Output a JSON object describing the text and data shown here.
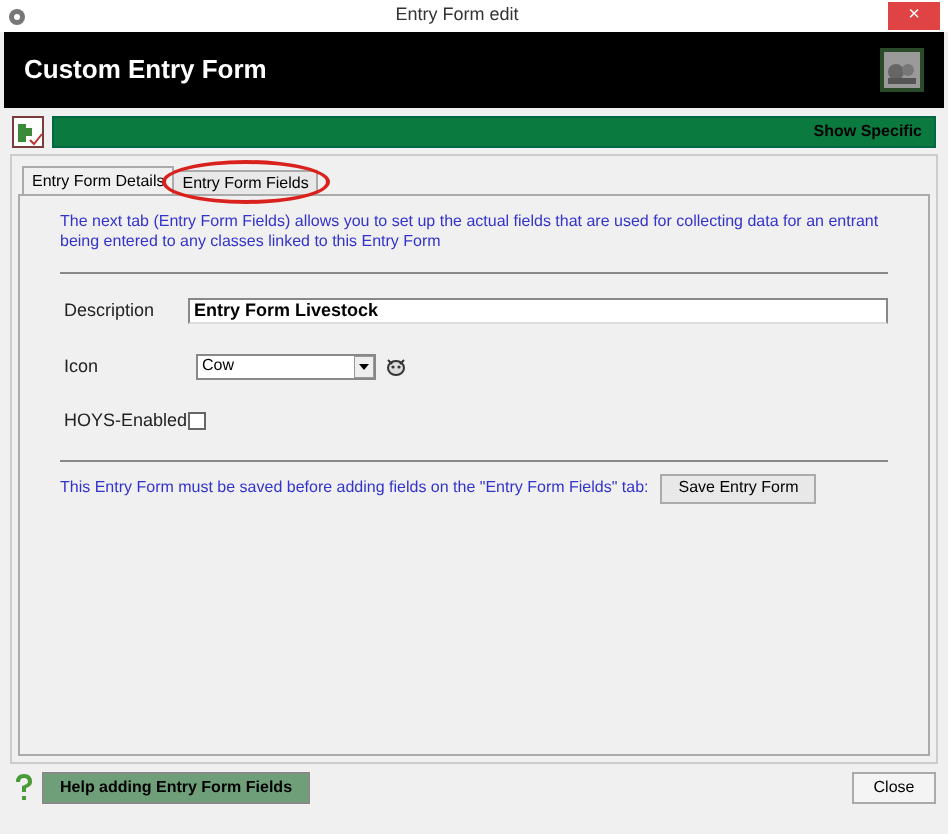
{
  "window": {
    "title": "Entry Form edit",
    "close": "×"
  },
  "header": {
    "title": "Custom Entry Form"
  },
  "toolbar": {
    "button": "Show Specific"
  },
  "tabs": [
    {
      "label": "Entry Form Details",
      "selected": true
    },
    {
      "label": "Entry Form Fields",
      "selected": false,
      "highlighted": true
    }
  ],
  "intro": "The next tab (Entry Form Fields) allows you to set up the actual fields that are used for collecting data for an entrant being entered to any classes linked to this Entry Form",
  "fields": [
    {
      "kind": "text",
      "label": "Description",
      "value": "Entry Form Livestock"
    },
    {
      "kind": "select",
      "label": "Icon",
      "value": "Cow"
    },
    {
      "kind": "checkbox",
      "label": "HOYS-Enabled",
      "checked": false
    }
  ],
  "save_note": "This Entry Form must be saved before adding fields on the \"Entry Form Fields\" tab:",
  "save_button": "Save Entry Form",
  "footer": {
    "help_button": "Help adding Entry Form Fields",
    "close_button": "Close"
  }
}
